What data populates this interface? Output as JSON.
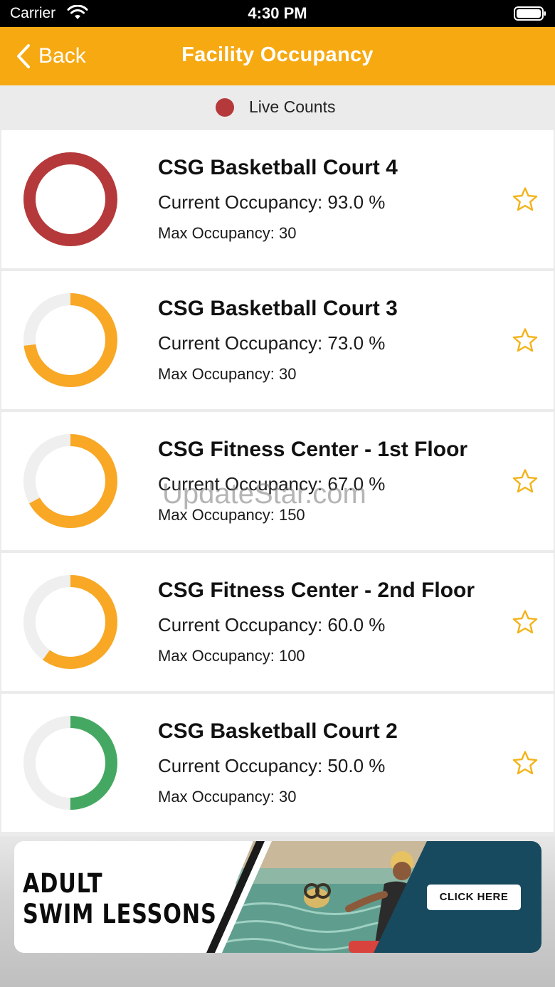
{
  "status_bar": {
    "carrier": "Carrier",
    "time": "4:30 PM",
    "wifi_icon": "wifi-icon",
    "battery_icon": "battery-icon"
  },
  "nav": {
    "back_label": "Back",
    "title": "Facility Occupancy",
    "back_icon": "chevron-left-icon",
    "background_color": "#f6a911"
  },
  "live": {
    "label": "Live Counts",
    "dot_color": "#b5393b"
  },
  "facilities": [
    {
      "name": "CSG Basketball Court 4",
      "occupancy_label": "Current Occupancy: 93.0 %",
      "occupancy_fraction": 1.0,
      "max_label": "Max Occupancy: 30",
      "ring_color": "#b5393b",
      "favorite_icon": "star-outline-icon"
    },
    {
      "name": "CSG Basketball Court 3",
      "occupancy_label": "Current Occupancy: 73.0 %",
      "occupancy_fraction": 0.73,
      "max_label": "Max Occupancy: 30",
      "ring_color": "#f8a825",
      "favorite_icon": "star-outline-icon"
    },
    {
      "name": "CSG Fitness Center - 1st Floor",
      "occupancy_label": "Current Occupancy: 67.0 %",
      "occupancy_fraction": 0.67,
      "max_label": "Max Occupancy: 150",
      "ring_color": "#f8a825",
      "favorite_icon": "star-outline-icon"
    },
    {
      "name": "CSG Fitness Center - 2nd Floor",
      "occupancy_label": "Current Occupancy: 60.0 %",
      "occupancy_fraction": 0.6,
      "max_label": "Max Occupancy: 100",
      "ring_color": "#f8a825",
      "favorite_icon": "star-outline-icon"
    },
    {
      "name": "CSG Basketball Court 2",
      "occupancy_label": "Current Occupancy: 50.0 %",
      "occupancy_fraction": 0.5,
      "max_label": "Max Occupancy: 30",
      "ring_color": "#45a862",
      "favorite_icon": "star-outline-icon"
    }
  ],
  "colors": {
    "ring_track": "#efefef",
    "star": "#f3b318"
  },
  "watermark": "UpdateStar.com",
  "banner": {
    "line1": "ADULT",
    "line2": "SWIM LESSONS",
    "cta": "CLICK HERE",
    "panel_color": "#174a5f"
  }
}
